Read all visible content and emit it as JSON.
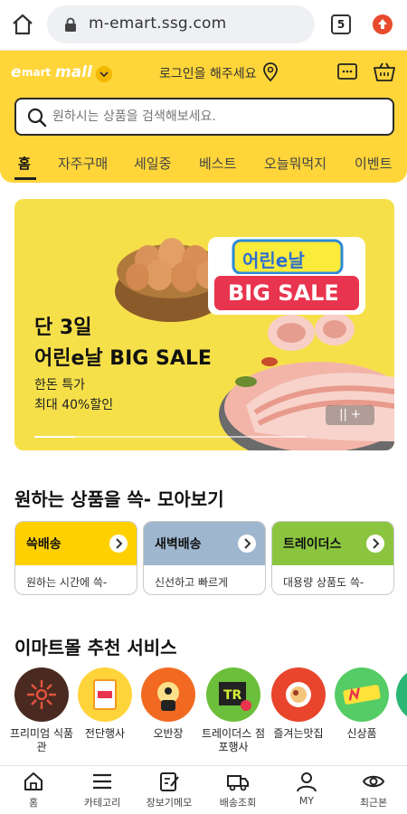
{
  "browser": {
    "url": "m-emart.ssg.com",
    "tab_count": "5"
  },
  "header": {
    "logo_e": "e",
    "logo_mart": "mart",
    "logo_mall": "mall",
    "login_message": "로그인을 해주세요",
    "search_placeholder": "원하시는 상품을 검색해보세요."
  },
  "tabs": [
    {
      "label": "홈",
      "active": true
    },
    {
      "label": "자주구매"
    },
    {
      "label": "세일중"
    },
    {
      "label": "베스트"
    },
    {
      "label": "오늘뭐먹지"
    },
    {
      "label": "이벤트"
    }
  ],
  "banner": {
    "title_line1": "단 3일",
    "title_line2": "어린e날 BIG SALE",
    "sub_line1": "한돈 특가",
    "sub_line2": "최대 40%할인",
    "badge_top": "어린e날",
    "badge_bottom": "BIG SALE",
    "pager": "||  +",
    "progress": 0.15
  },
  "collection": {
    "title": "원하는 상품을 쓱- 모아보기",
    "cards": [
      {
        "title": "쓱배송",
        "desc": "원하는 시간에 쓱-",
        "color": "#ffd000"
      },
      {
        "title": "새벽배송",
        "desc": "신선하고 빠르게",
        "color": "#9fb6cf"
      },
      {
        "title": "트레이더스",
        "desc": "대용량 상품도 쓱-",
        "color": "#8bc53f"
      }
    ]
  },
  "services": {
    "title": "이마트몰 추천 서비스",
    "items": [
      {
        "label": "프리미엄 식품관",
        "icon": "premium-food-icon",
        "color": "#4a2a20"
      },
      {
        "label": "전단행사",
        "icon": "flyer-icon",
        "color": "#ffd43b"
      },
      {
        "label": "오반장",
        "icon": "obanjang-icon",
        "color": "#f26a21"
      },
      {
        "label": "트레이더스 점포행사",
        "icon": "traders-icon",
        "color": "#6cbf3a"
      },
      {
        "label": "즐겨는맛집",
        "icon": "restaurant-icon",
        "color": "#e8452c"
      },
      {
        "label": "신상품",
        "icon": "new-icon",
        "color": "#55cc66"
      }
    ]
  },
  "bottom_nav": [
    {
      "label": "홈",
      "icon": "home-icon"
    },
    {
      "label": "카테고리",
      "icon": "menu-icon"
    },
    {
      "label": "장보기메모",
      "icon": "memo-icon"
    },
    {
      "label": "배송조회",
      "icon": "truck-icon"
    },
    {
      "label": "MY",
      "icon": "person-icon"
    },
    {
      "label": "최근본",
      "icon": "eye-icon"
    }
  ]
}
